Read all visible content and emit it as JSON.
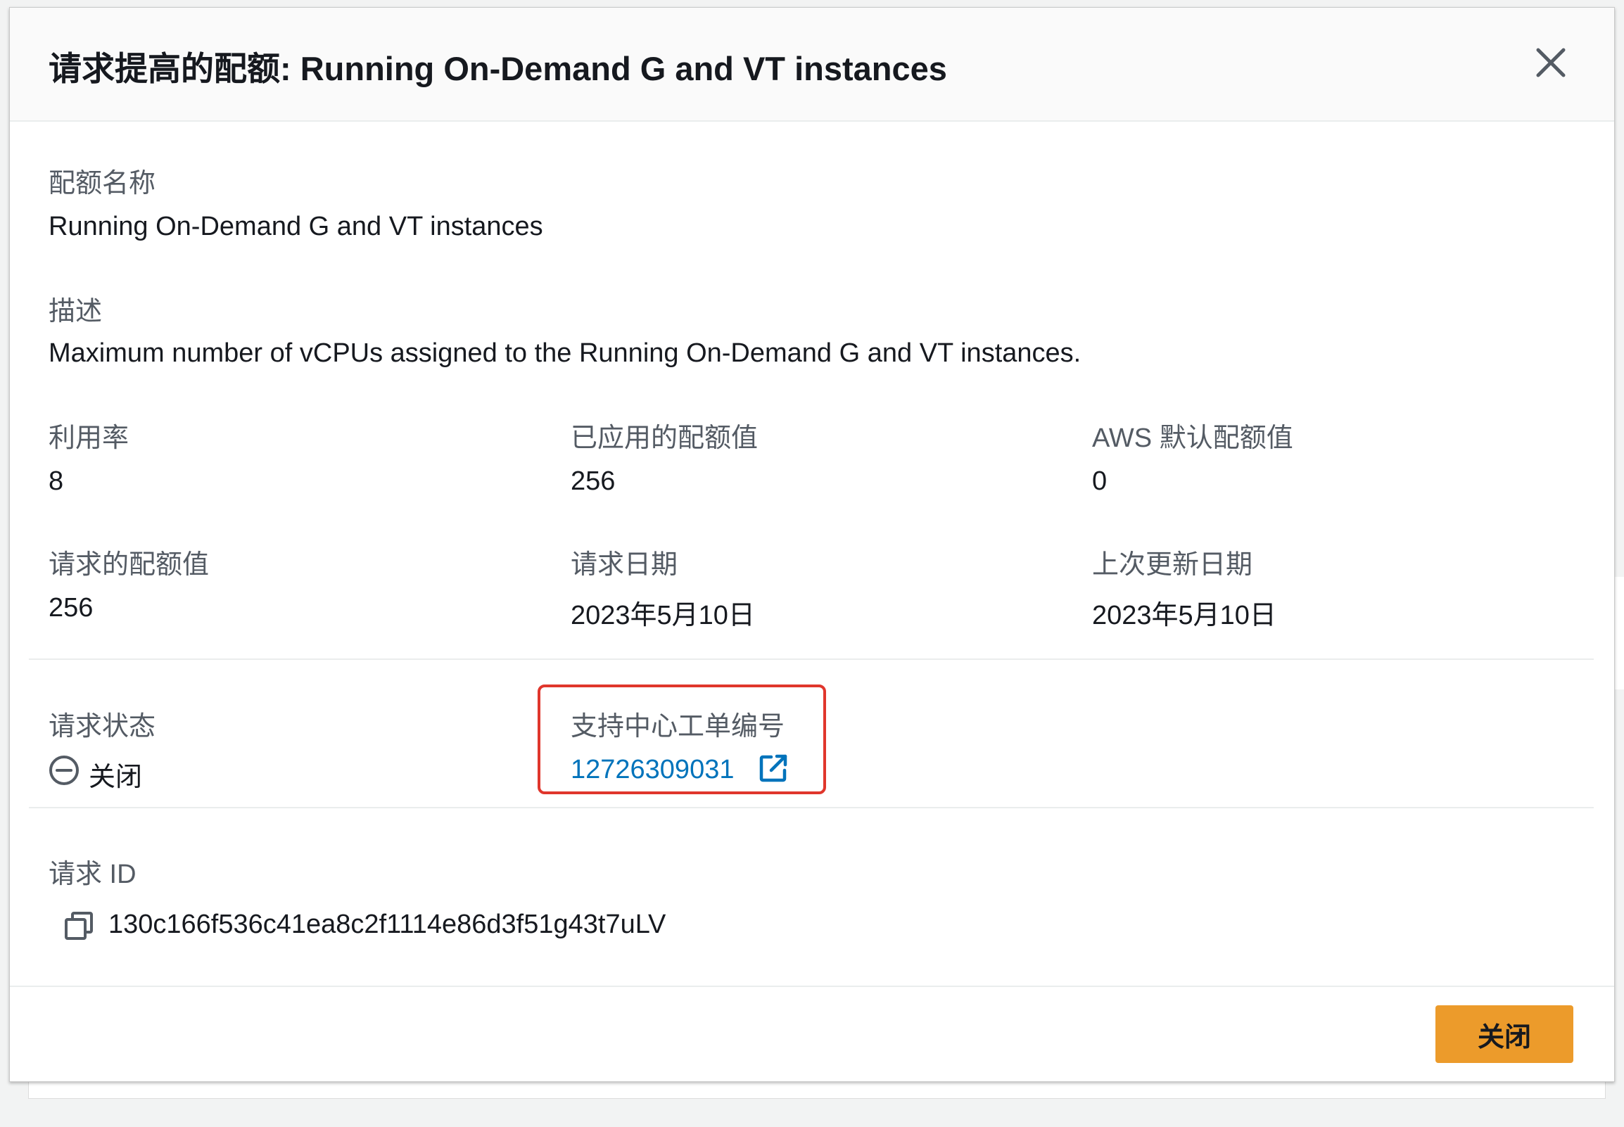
{
  "modal": {
    "title": "请求提高的配额: Running On-Demand G and VT instances",
    "close_icon": "close-icon"
  },
  "quota_name": {
    "label": "配额名称",
    "value": "Running On-Demand G and VT instances"
  },
  "description": {
    "label": "描述",
    "value": "Maximum number of vCPUs assigned to the Running On-Demand G and VT instances."
  },
  "utilization": {
    "label": "利用率",
    "value": "8"
  },
  "applied_quota": {
    "label": "已应用的配额值",
    "value": "256"
  },
  "aws_default_quota": {
    "label": "AWS 默认配额值",
    "value": "0"
  },
  "requested_quota": {
    "label": "请求的配额值",
    "value": "256"
  },
  "request_date": {
    "label": "请求日期",
    "value": "2023年5月10日"
  },
  "last_updated": {
    "label": "上次更新日期",
    "value": "2023年5月10日"
  },
  "request_status": {
    "label": "请求状态",
    "value": "关闭",
    "icon": "status-closed-icon"
  },
  "support_case": {
    "label": "支持中心工单编号",
    "value": "12726309031",
    "icon": "external-link-icon",
    "highlight_color": "#e0362c"
  },
  "request_id": {
    "label": "请求 ID",
    "value": "130c166f536c41ea8c2f1114e86d3f51g43t7uLV",
    "icon": "copy-icon"
  },
  "footer": {
    "close_button_label": "关闭"
  },
  "colors": {
    "primary_button": "#ec9b2b",
    "link": "#0073bb",
    "label": "#545b64",
    "text": "#16191f"
  }
}
